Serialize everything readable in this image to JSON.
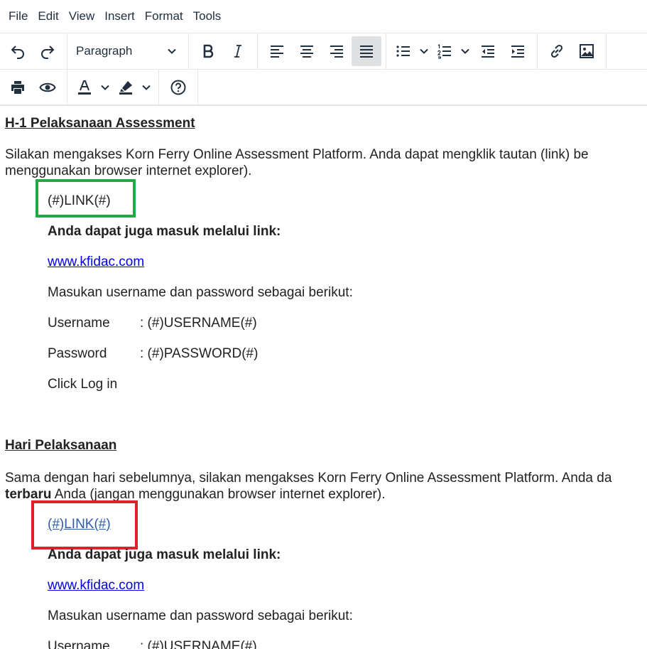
{
  "menubar": {
    "items": [
      "File",
      "Edit",
      "View",
      "Insert",
      "Format",
      "Tools"
    ]
  },
  "toolbar": {
    "undo_icon": "undo-icon",
    "redo_icon": "redo-icon",
    "block_format": "Paragraph",
    "active_align": "justify",
    "icons_row1": [
      "bold-icon",
      "italic-icon",
      "align-left-icon",
      "align-center-icon",
      "align-right-icon",
      "align-justify-icon",
      "bullet-list-icon",
      "numbered-list-icon",
      "outdent-icon",
      "indent-icon",
      "link-icon",
      "image-icon"
    ],
    "icons_row2": [
      "print-icon",
      "preview-icon",
      "text-color-icon",
      "highlight-color-icon",
      "help-icon"
    ]
  },
  "content": {
    "section1": {
      "heading": "H-1 Pelaksanaan Assessment",
      "para_line1": "Silakan mengakses Korn Ferry Online Assessment Platform. Anda dapat mengklik tautan (link) be",
      "para_line2": "menggunakan browser internet explorer).",
      "link_placeholder": "(#)LINK(#)",
      "also_label": "Anda dapat juga masuk melalui link:",
      "site_link": "www.kfidac.com",
      "credentials_intro": "Masukan username dan password sebagai berikut:",
      "username_label": "Username",
      "username_value": ": (#)USERNAME(#)",
      "password_label": "Password",
      "password_value": ": (#)PASSWORD(#)",
      "login_instruction": "Click Log in"
    },
    "section2": {
      "heading": "Hari Pelaksanaan",
      "para_line1": " Sama dengan hari sebelumnya, silakan mengakses Korn Ferry Online Assessment Platform. Anda da",
      "para_line2_bold": "terbaru",
      "para_line2_rest": " Anda (jangan menggunakan browser internet explorer).",
      "link_placeholder": "(#)LINK(#)",
      "also_label": "Anda dapat juga masuk melalui link:",
      "site_link": "www.kfidac.com",
      "credentials_intro": "Masukan username dan password sebagai berikut:",
      "username_label": "Username",
      "username_value": ": (#)USERNAME(#)"
    }
  },
  "annotations": {
    "green_box_color": "#22a845",
    "red_box_color": "#e0202b"
  }
}
